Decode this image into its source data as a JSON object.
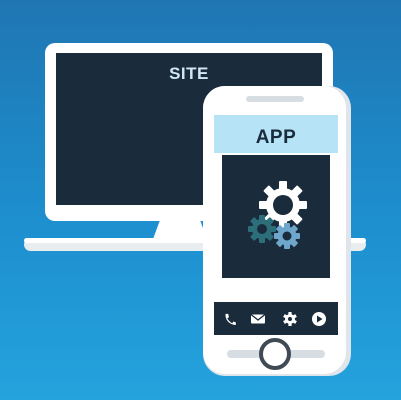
{
  "monitor": {
    "label": "SITE"
  },
  "phone": {
    "label": "APP",
    "toolbar_icons": [
      "phone-icon",
      "mail-icon",
      "settings-icon",
      "play-icon"
    ]
  },
  "colors": {
    "background_top": "#1f76b2",
    "background_bottom": "#24a3dd",
    "screen_dark": "#1a2b3c",
    "frame_white": "#ffffff",
    "frame_shadow": "#e1e6ea",
    "app_header": "#b7e3f6",
    "gear_white": "#ffffff",
    "gear_teal": "#2c6e7a",
    "gear_blue": "#6fa6cc"
  }
}
